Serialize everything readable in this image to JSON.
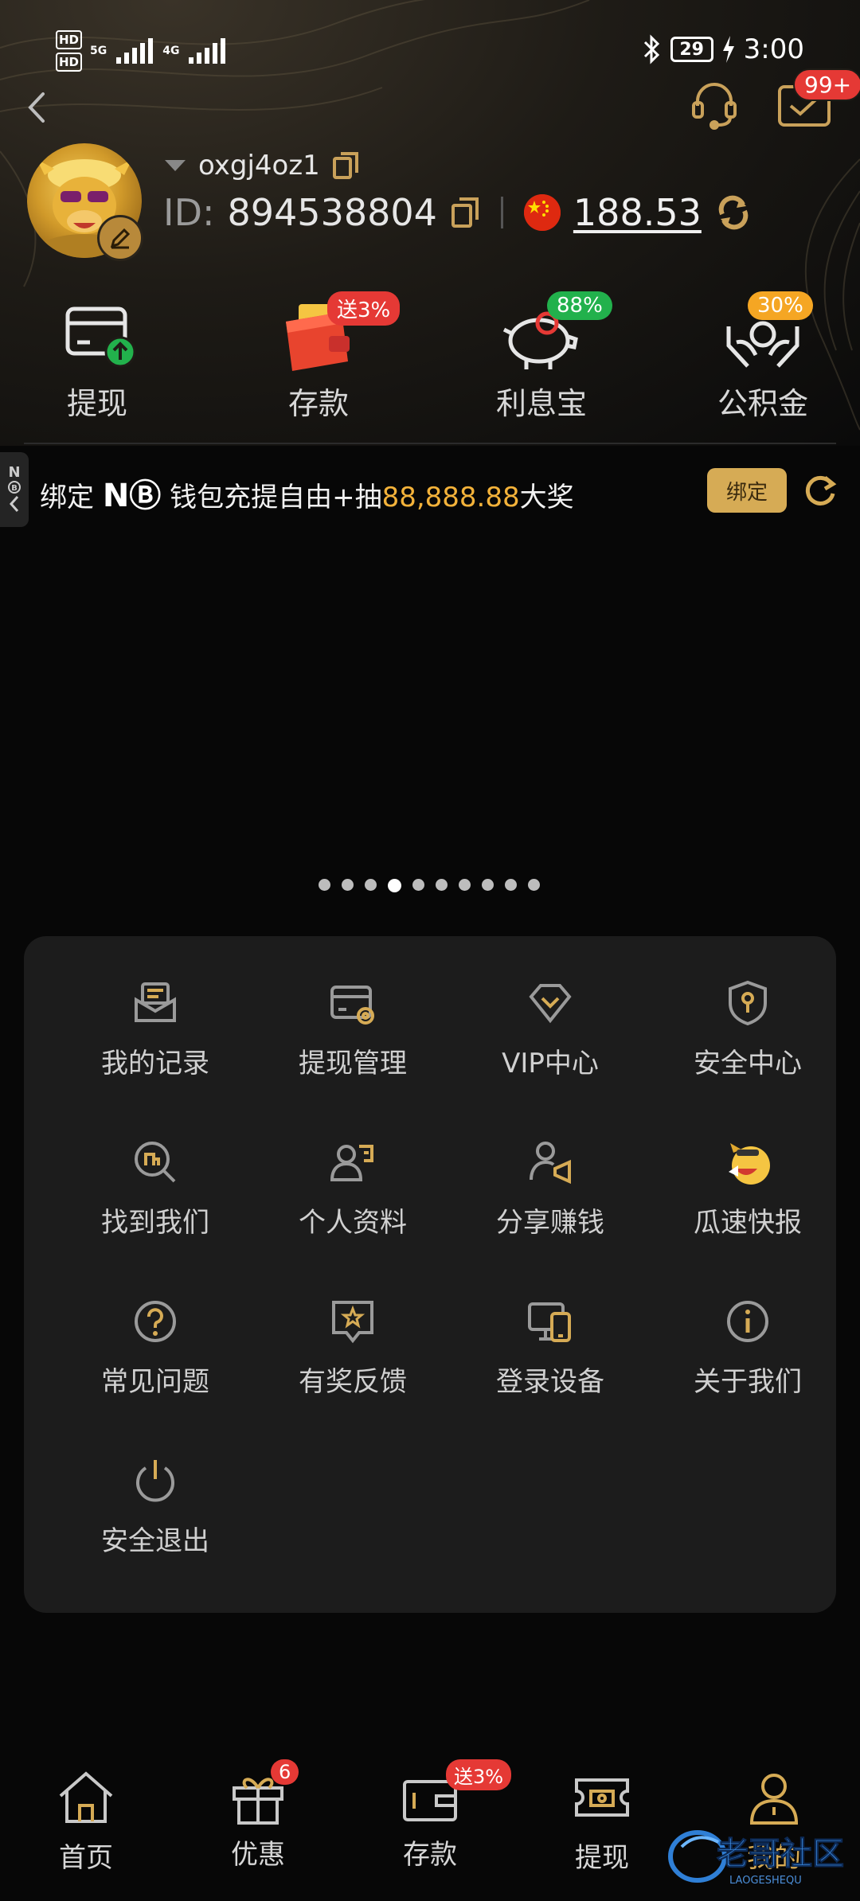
{
  "status_bar": {
    "net1": "HD",
    "net2": "HD",
    "sig1": "5G",
    "sig2": "4G",
    "battery": "29",
    "time": "3:00"
  },
  "header": {
    "message_badge": "99+"
  },
  "profile": {
    "username": "oxgj4oz1",
    "id_label": "ID:",
    "id_value": "894538804",
    "balance": "188.53"
  },
  "quick_actions": [
    {
      "label": "提现",
      "badge": ""
    },
    {
      "label": "存款",
      "badge": "送3%"
    },
    {
      "label": "利息宝",
      "badge": "88%"
    },
    {
      "label": "公积金",
      "badge": "30%"
    }
  ],
  "side_tab": {
    "text": "N"
  },
  "promo": {
    "prefix": "绑定 ",
    "brand": "NⒷ",
    "middle": " 钱包充提自由+抽",
    "amount": "88,888.88",
    "suffix": "大奖",
    "bind_label": "绑定"
  },
  "carousel": {
    "count": 10,
    "active": 3
  },
  "menu": [
    {
      "label": "我的记录",
      "icon": "record-icon"
    },
    {
      "label": "提现管理",
      "icon": "withdraw-card-icon"
    },
    {
      "label": "VIP中心",
      "icon": "vip-diamond-icon"
    },
    {
      "label": "安全中心",
      "icon": "shield-key-icon"
    },
    {
      "label": "找到我们",
      "icon": "search-building-icon"
    },
    {
      "label": "个人资料",
      "icon": "profile-card-icon"
    },
    {
      "label": "分享赚钱",
      "icon": "share-megaphone-icon"
    },
    {
      "label": "瓜速快报",
      "icon": "news-mascot-icon"
    },
    {
      "label": "常见问题",
      "icon": "question-icon"
    },
    {
      "label": "有奖反馈",
      "icon": "feedback-star-icon"
    },
    {
      "label": "登录设备",
      "icon": "devices-icon"
    },
    {
      "label": "关于我们",
      "icon": "info-icon"
    },
    {
      "label": "安全退出",
      "icon": "power-icon"
    }
  ],
  "tabbar": [
    {
      "label": "首页",
      "badge": ""
    },
    {
      "label": "优惠",
      "badge": "6"
    },
    {
      "label": "存款",
      "badge": "送3%"
    },
    {
      "label": "提现",
      "badge": ""
    },
    {
      "label": "我的",
      "badge": ""
    }
  ],
  "watermark": {
    "text": "老哥社区",
    "sub": "LAOGESHEQU"
  },
  "colors": {
    "gold": "#d6ab55",
    "accent_orange": "#f3b23a",
    "badge_red": "#e53935",
    "badge_green": "#22b14c",
    "badge_orange": "#f5a623",
    "panel": "#1c1c1c",
    "background": "#070707"
  }
}
